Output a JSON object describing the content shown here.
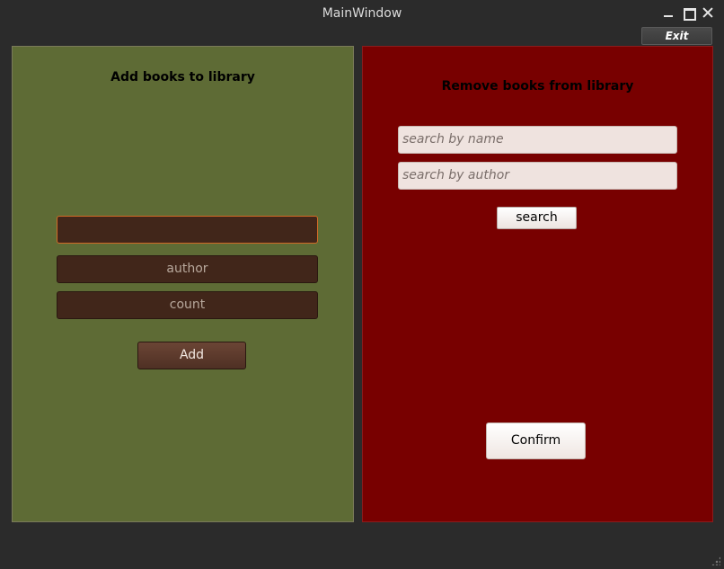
{
  "window": {
    "title": "MainWindow"
  },
  "titlebar_buttons": {
    "minimize": "minimize-icon",
    "maximize": "maximize-icon",
    "close": "close-icon"
  },
  "toolbar": {
    "exit_label": "Exit"
  },
  "add_panel": {
    "title": "Add books to library",
    "title_field_value": "",
    "author_placeholder": "author",
    "count_placeholder": "count",
    "add_label": "Add",
    "background": "#5e6b35"
  },
  "remove_panel": {
    "title": "Remove books from library",
    "name_placeholder": "search by name",
    "author_placeholder": "search by author",
    "search_label": "search",
    "confirm_label": "Confirm",
    "background": "#780000"
  }
}
